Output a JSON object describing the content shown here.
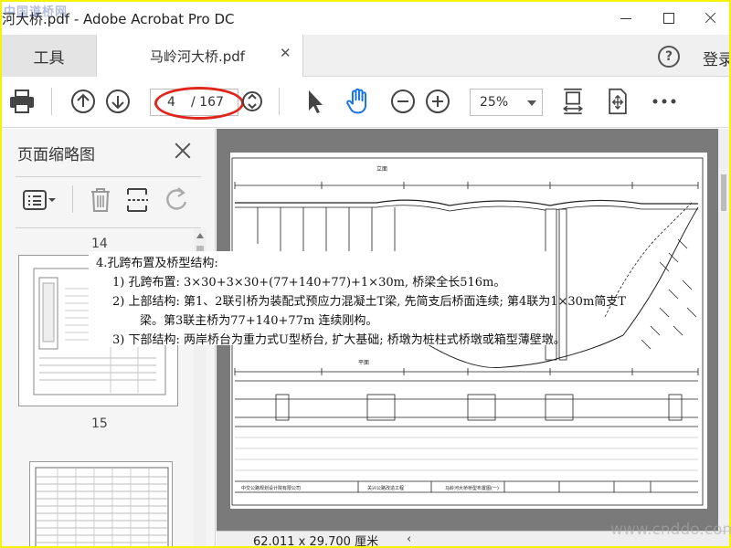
{
  "window": {
    "title": "河大桥.pdf - Adobe Acrobat Pro DC",
    "logo_watermark": "中国道桥网"
  },
  "tabs": {
    "tools_label": "工具",
    "doc_label": "马岭河大桥.pdf",
    "login_label": "登录"
  },
  "toolbar": {
    "current_page": "4",
    "total_pages": "/ 167",
    "zoom": "25%"
  },
  "thumbnail_panel": {
    "title": "页面缩略图",
    "pages": [
      "14",
      "15"
    ]
  },
  "tooltip": {
    "heading": "4.孔跨布置及桥型结构:",
    "line1": "1) 孔跨布置: 3×30+3×30+(77+140+77)+1×30m, 桥梁全长516m。",
    "line2a": "2) 上部结构: 第1、2联引桥为装配式预应力混凝土T梁, 先简支后桥面连续; 第4联为1×30m简支T",
    "line2b": "梁。第3联主桥为77+140+77m 连续刚构。",
    "line3": "3) 下部结构: 两岸桥台为重力式U型桥台, 扩大基础; 桥墩为桩柱式桥墩或箱型薄壁墩。"
  },
  "drawing": {
    "top_label": "立面",
    "plan_label": "平面",
    "designer": "中交公路规划设计院有限公司",
    "project": "关兴公路改造工程",
    "sheet_title": "马岭河大桥桥型布置图(一)"
  },
  "status": {
    "dimensions": "62.011 x 29.700 厘米"
  },
  "site_watermark": "www.cnddo.com",
  "colors": {
    "accent_blue": "#1473e6",
    "annotation_red": "#e0261b",
    "frame_yellow": "#f4f400"
  }
}
